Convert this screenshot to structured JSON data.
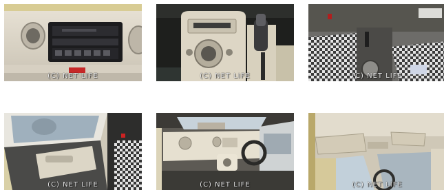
{
  "watermark": "(C) NET LIFE",
  "photos": [
    {
      "subject": "dashboard center console with CD/radio head unit and round air vents"
    },
    {
      "subject": "center panel with climate dial and automatic gear shift lever"
    },
    {
      "subject": "driver footwell with pedals and checkered floor mats"
    },
    {
      "subject": "front door interior trim panel with window switches"
    },
    {
      "subject": "full dashboard view from rear seat with steering wheel"
    },
    {
      "subject": "headliner with sun visors and rear-view mirror"
    }
  ]
}
